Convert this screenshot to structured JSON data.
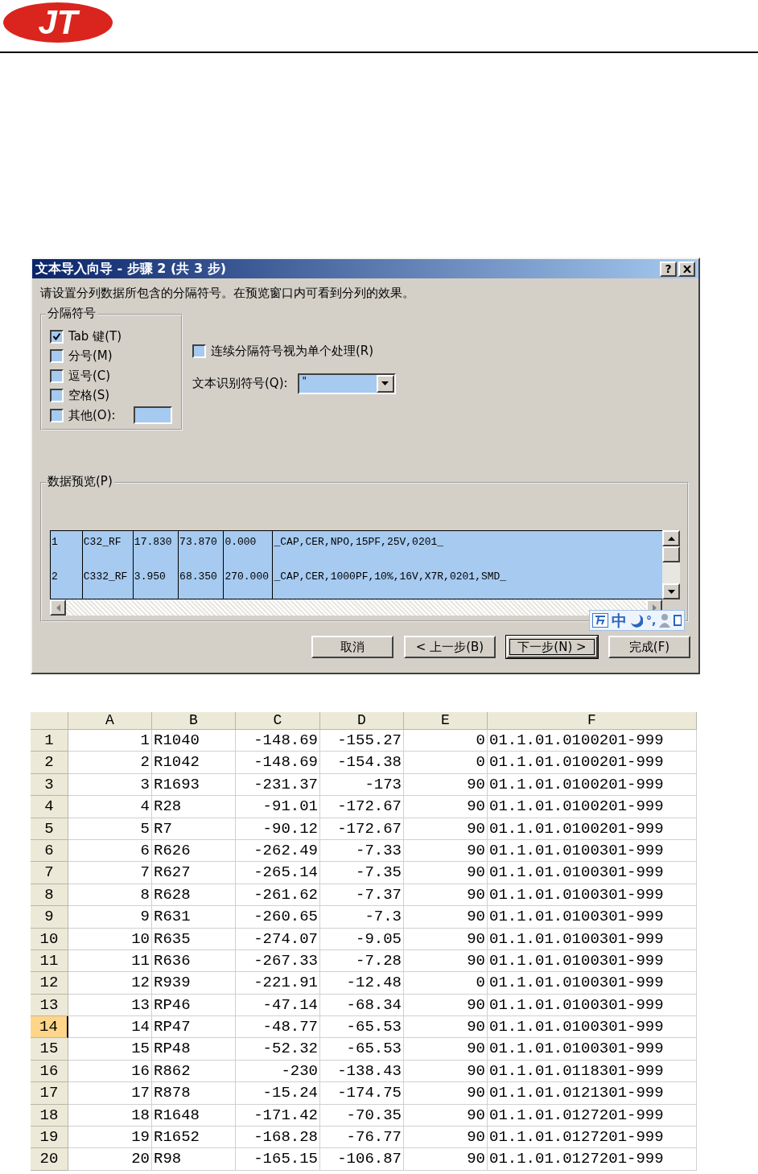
{
  "logo": {
    "text": "JT"
  },
  "dialog": {
    "title": "文本导入向导 - 步骤 2 (共 3 步)",
    "help": "?",
    "instruction": "请设置分列数据所包含的分隔符号。在预览窗口内可看到分列的效果。",
    "delimiters": {
      "legend": "分隔符号",
      "options": [
        {
          "label": "Tab 键(T)",
          "checked": true,
          "kind": "plain"
        },
        {
          "label": "分号(M)",
          "checked": false,
          "kind": "plain"
        },
        {
          "label": "逗号(C)",
          "checked": false,
          "kind": "plain"
        },
        {
          "label": "空格(S)",
          "checked": false,
          "kind": "plain"
        },
        {
          "label": "其他(O):",
          "checked": false,
          "kind": "other"
        }
      ]
    },
    "consecutive": {
      "label": "连续分隔符号视为单个处理(R)",
      "checked": false
    },
    "qualifier": {
      "label": "文本识别符号(Q):",
      "value": "\""
    },
    "preview": {
      "legend": "数据预览(P)",
      "rows": [
        [
          "1",
          "C32_RF",
          "17.830",
          "73.870",
          "0.000",
          "_CAP,CER,NPO,15PF,25V,0201_"
        ],
        [
          "2",
          "C332_RF",
          "3.950",
          "68.350",
          "270.000",
          "_CAP,CER,1000PF,10%,16V,X7R,0201,SMD_"
        ]
      ]
    },
    "buttons": [
      {
        "label": "取消",
        "focused": false
      },
      {
        "label": "< 上一步(B)",
        "focused": false
      },
      {
        "label": "下一步(N) >",
        "focused": true
      },
      {
        "label": "完成(F)",
        "focused": false
      }
    ],
    "ime_bar": {
      "text": "中",
      "punct": "°,"
    }
  },
  "sheet": {
    "columns": [
      "A",
      "B",
      "C",
      "D",
      "E",
      "F"
    ],
    "rows": [
      {
        "header": "1",
        "selected": false,
        "cells": [
          "1",
          "R1040",
          "-148.69",
          "-155.27",
          "0",
          "01.1.01.0100201-999"
        ]
      },
      {
        "header": "2",
        "selected": false,
        "cells": [
          "2",
          "R1042",
          "-148.69",
          "-154.38",
          "0",
          "01.1.01.0100201-999"
        ]
      },
      {
        "header": "3",
        "selected": false,
        "cells": [
          "3",
          "R1693",
          "-231.37",
          "-173",
          "90",
          "01.1.01.0100201-999"
        ]
      },
      {
        "header": "4",
        "selected": false,
        "cells": [
          "4",
          "R28",
          "-91.01",
          "-172.67",
          "90",
          "01.1.01.0100201-999"
        ]
      },
      {
        "header": "5",
        "selected": false,
        "cells": [
          "5",
          "R7",
          "-90.12",
          "-172.67",
          "90",
          "01.1.01.0100201-999"
        ]
      },
      {
        "header": "6",
        "selected": false,
        "cells": [
          "6",
          "R626",
          "-262.49",
          "-7.33",
          "90",
          "01.1.01.0100301-999"
        ]
      },
      {
        "header": "7",
        "selected": false,
        "cells": [
          "7",
          "R627",
          "-265.14",
          "-7.35",
          "90",
          "01.1.01.0100301-999"
        ]
      },
      {
        "header": "8",
        "selected": false,
        "cells": [
          "8",
          "R628",
          "-261.62",
          "-7.37",
          "90",
          "01.1.01.0100301-999"
        ]
      },
      {
        "header": "9",
        "selected": false,
        "cells": [
          "9",
          "R631",
          "-260.65",
          "-7.3",
          "90",
          "01.1.01.0100301-999"
        ]
      },
      {
        "header": "10",
        "selected": false,
        "cells": [
          "10",
          "R635",
          "-274.07",
          "-9.05",
          "90",
          "01.1.01.0100301-999"
        ]
      },
      {
        "header": "11",
        "selected": false,
        "cells": [
          "11",
          "R636",
          "-267.33",
          "-7.28",
          "90",
          "01.1.01.0100301-999"
        ]
      },
      {
        "header": "12",
        "selected": false,
        "cells": [
          "12",
          "R939",
          "-221.91",
          "-12.48",
          "0",
          "01.1.01.0100301-999"
        ]
      },
      {
        "header": "13",
        "selected": false,
        "cells": [
          "13",
          "RP46",
          "-47.14",
          "-68.34",
          "90",
          "01.1.01.0100301-999"
        ]
      },
      {
        "header": "14",
        "selected": true,
        "cells": [
          "14",
          "RP47",
          "-48.77",
          "-65.53",
          "90",
          "01.1.01.0100301-999"
        ]
      },
      {
        "header": "15",
        "selected": false,
        "cells": [
          "15",
          "RP48",
          "-52.32",
          "-65.53",
          "90",
          "01.1.01.0100301-999"
        ]
      },
      {
        "header": "16",
        "selected": false,
        "cells": [
          "16",
          "R862",
          "-230",
          "-138.43",
          "90",
          "01.1.01.0118301-999"
        ]
      },
      {
        "header": "17",
        "selected": false,
        "cells": [
          "17",
          "R878",
          "-15.24",
          "-174.75",
          "90",
          "01.1.01.0121301-999"
        ]
      },
      {
        "header": "18",
        "selected": false,
        "cells": [
          "18",
          "R1648",
          "-171.42",
          "-70.35",
          "90",
          "01.1.01.0127201-999"
        ]
      },
      {
        "header": "19",
        "selected": false,
        "cells": [
          "19",
          "R1652",
          "-168.28",
          "-76.77",
          "90",
          "01.1.01.0127201-999"
        ]
      },
      {
        "header": "20",
        "selected": false,
        "cells": [
          "20",
          "R98",
          "-165.15",
          "-106.87",
          "90",
          "01.1.01.0127201-999"
        ]
      }
    ]
  }
}
